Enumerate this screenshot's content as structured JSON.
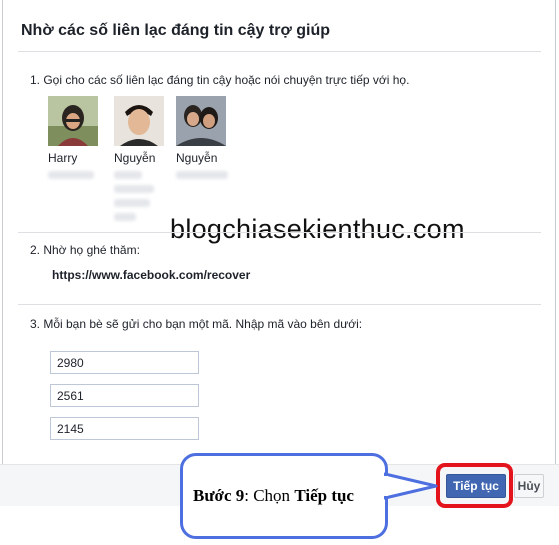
{
  "dialog": {
    "title": "Nhờ các số liên lạc đáng tin cậy trợ giúp"
  },
  "step1": {
    "text": "1. Gọi cho các số liên lạc đáng tin cậy hoặc nói chuyện trực tiếp với họ."
  },
  "friends": [
    {
      "name": "Harry"
    },
    {
      "name": "Nguyễn"
    },
    {
      "name": "Nguyễn"
    }
  ],
  "step2": {
    "text": "2. Nhờ họ ghé thăm:",
    "url": "https://www.facebook.com/recover"
  },
  "step3": {
    "text": "3. Mỗi bạn bè sẽ gửi cho bạn một mã. Nhập mã vào bên dưới:",
    "codes": [
      "2980",
      "2561",
      "2145"
    ]
  },
  "buttons": {
    "continue": "Tiếp tục",
    "cancel": "Hủy"
  },
  "watermark": "blogchiasekienthuc.com",
  "callout": {
    "step_label": "Bước 9",
    "separator": ": Chọn ",
    "action": "Tiếp tục"
  },
  "colors": {
    "primary_button": "#4267b2",
    "highlight_border": "#e3141b",
    "callout_border": "#4d6fe0"
  }
}
